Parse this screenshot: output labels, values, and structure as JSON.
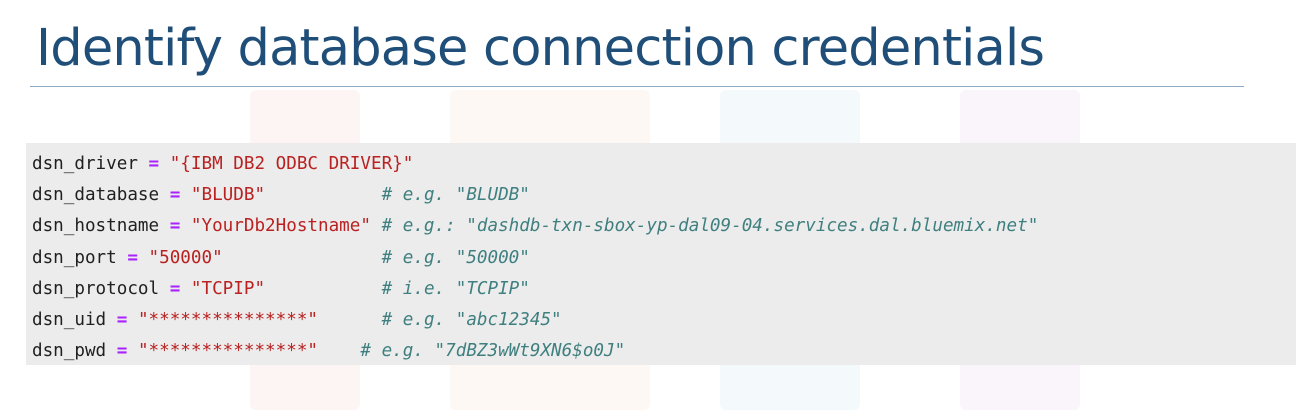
{
  "slide": {
    "title": "Identify database connection credentials"
  },
  "code": {
    "lines": [
      {
        "var": "dsn_driver",
        "op": "=",
        "value": "\"{IBM DB2 ODBC DRIVER}\"",
        "pad": "",
        "comment": ""
      },
      {
        "var": "dsn_database",
        "op": "=",
        "value": "\"BLUDB\"",
        "pad": "           ",
        "comment": "# e.g. \"BLUDB\""
      },
      {
        "var": "dsn_hostname",
        "op": "=",
        "value": "\"YourDb2Hostname\"",
        "pad": " ",
        "comment": "# e.g.: \"dashdb-txn-sbox-yp-dal09-04.services.dal.bluemix.net\""
      },
      {
        "var": "dsn_port",
        "op": "=",
        "value": "\"50000\"",
        "pad": "               ",
        "comment": "# e.g. \"50000\""
      },
      {
        "var": "dsn_protocol",
        "op": "=",
        "value": "\"TCPIP\"",
        "pad": "           ",
        "comment": "# i.e. \"TCPIP\""
      },
      {
        "var": "dsn_uid",
        "op": "=",
        "value": "\"***************\"",
        "pad": "      ",
        "comment": "# e.g. \"abc12345\""
      },
      {
        "var": "dsn_pwd",
        "op": "=",
        "value": "\"***************\"",
        "pad": "    ",
        "comment": "# e.g. \"7dBZ3wWt9XN6$o0J\""
      }
    ]
  },
  "colors": {
    "title": "#1f4e79",
    "code_background": "#ececec",
    "operator": "#aa22ff",
    "string": "#ba2121",
    "comment": "#3f7f7f"
  }
}
